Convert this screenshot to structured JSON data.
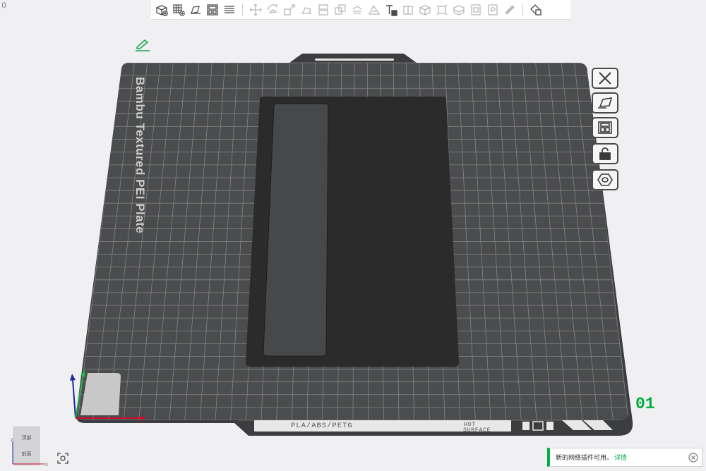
{
  "toolbar": {
    "icons": [
      "add-object-icon",
      "add-plate-icon",
      "orient-icon",
      "arrange-icon",
      "plate-list-icon",
      "move-icon",
      "rotate-icon",
      "scale-icon",
      "lay-on-face-icon",
      "cut-icon",
      "boolean-icon",
      "paint-support-icon",
      "seam-paint-icon",
      "text-icon",
      "split-objects-icon",
      "split-parts-icon",
      "measure-icon",
      "assembly-icon",
      "variable-layer-icon",
      "color-paint-icon",
      "brim-ears-icon",
      "settings-icon"
    ]
  },
  "bed": {
    "label": "Bambu Textured PEI Plate",
    "plate_number": "01",
    "strip_text": "PLA/ABS/PETG",
    "hot_surface_line1": "HOT",
    "hot_surface_line2": "SURFACE",
    "colors": {
      "surface": "#4b4c4d",
      "grid": "#8e8e8e",
      "object": "#2b2b2b"
    }
  },
  "side_tools": [
    {
      "name": "close-icon"
    },
    {
      "name": "auto-plate-icon"
    },
    {
      "name": "arrange-plate-icon"
    },
    {
      "name": "lock-icon"
    },
    {
      "name": "plate-settings-icon"
    }
  ],
  "view_cube": {
    "top_label": "顶部",
    "front_label": "前面"
  },
  "toast": {
    "message": "新的网络插件可用。",
    "link": "详情"
  }
}
